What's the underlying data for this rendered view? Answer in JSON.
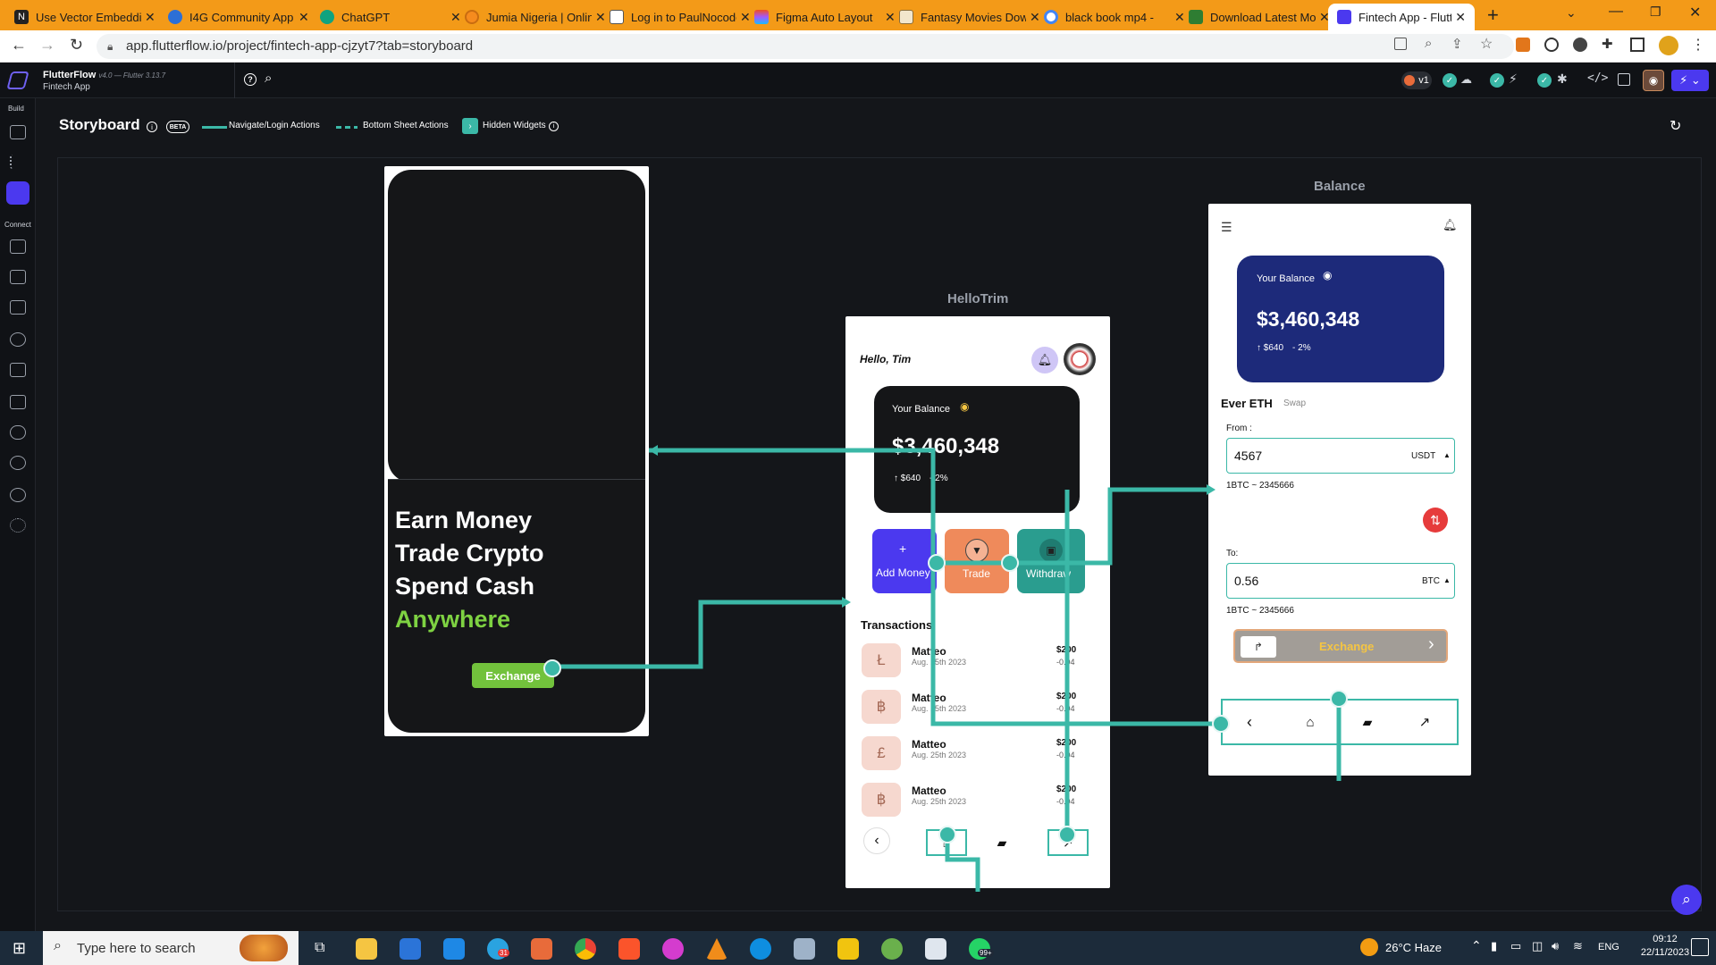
{
  "browser": {
    "tabs": [
      {
        "label": "Use Vector Embedding",
        "icon": "notion-icon",
        "color": "#222222"
      },
      {
        "label": "I4G Community App",
        "icon": "globe-icon",
        "color": "#2c6fd6"
      },
      {
        "label": "ChatGPT",
        "icon": "openai-icon",
        "color": "#10a37f"
      },
      {
        "label": "Jumia Nigeria | Online",
        "icon": "jumia-icon",
        "color": "#f68b1e"
      },
      {
        "label": "Log in to PaulNocode",
        "icon": "page-icon",
        "color": "#555555"
      },
      {
        "label": "Figma Auto Layout",
        "icon": "figma-icon",
        "color": "#a259ff"
      },
      {
        "label": "Fantasy Movies Download",
        "icon": "page-icon",
        "color": "#8a6d3b"
      },
      {
        "label": "black book mp4 -",
        "icon": "google-icon",
        "color": "#4285f4"
      },
      {
        "label": "Download Latest Movies",
        "icon": "page-icon",
        "color": "#2e7d32"
      },
      {
        "label": "Fintech App - Flutter",
        "icon": "flutterflow-icon",
        "color": "#4b39ef"
      }
    ],
    "url": "app.flutterflow.io/project/fintech-app-cjzyt7?tab=storyboard"
  },
  "ff": {
    "brand": "FlutterFlow",
    "version": "v4.0 — Flutter 3.13.7",
    "project": "Fintech App",
    "rail_build": "Build",
    "rail_connect": "Connect",
    "version_badge": "v1"
  },
  "storyboard": {
    "title": "Storyboard",
    "beta": "BETA",
    "legend_navigate": "Navigate/Login Actions",
    "legend_bottom": "Bottom Sheet Actions",
    "legend_hidden": "Hidden Widgets"
  },
  "onboarding": {
    "line1": "Earn Money",
    "line2": "Trade Crypto",
    "line3": "Spend Cash",
    "line4": "Anywhere",
    "button": "Exchange"
  },
  "hellotrim": {
    "page_title": "HelloTrim",
    "greeting": "Hello, Tim",
    "balance_label": "Your Balance",
    "balance": "$3,460,348",
    "change_amount": "$640",
    "change_pct": "- 2%",
    "action_add": "Add Money",
    "action_trade": "Trade",
    "action_withdraw": "Withdraw",
    "transactions_title": "Transactions",
    "transactions": [
      {
        "name": "Matteo",
        "date": "Aug. 25th 2023",
        "amount": "$200",
        "change": "-0.04",
        "icon": "Ł"
      },
      {
        "name": "Matteo",
        "date": "Aug. 25th 2023",
        "amount": "$200",
        "change": "-0.04",
        "icon": "฿"
      },
      {
        "name": "Matteo",
        "date": "Aug. 25th 2023",
        "amount": "$200",
        "change": "-0.04",
        "icon": "£"
      },
      {
        "name": "Matteo",
        "date": "Aug. 25th 2023",
        "amount": "$200",
        "change": "-0.04",
        "icon": "฿"
      }
    ]
  },
  "balance_page": {
    "page_title": "Balance",
    "balance_label": "Your Balance",
    "balance": "$3,460,348",
    "change_amount": "$640",
    "change_pct": "- 2%",
    "ever_eth": "Ever ETH",
    "swap": "Swap",
    "from_label": "From :",
    "from_value": "4567",
    "from_currency": "USDT",
    "rate1": "1BTC ~ 2345666",
    "to_label": "To:",
    "to_value": "0.56",
    "to_currency": "BTC",
    "rate2": "1BTC ~ 2345666",
    "exchange": "Exchange"
  },
  "taskbar": {
    "search_placeholder": "Type here to search",
    "weather": "26°C  Haze",
    "lang": "ENG",
    "time": "09:12",
    "date": "22/11/2023",
    "whatsapp_badge": "99+",
    "telegram_badge": "31"
  },
  "colors": {
    "accent": "#3bb8a7",
    "ffbg": "#14161a",
    "navy_card": "#1d2a7a",
    "dark_card": "#151618",
    "green_text": "#7ed242",
    "add_money": "#4b39ef",
    "trade": "#ef8a5b",
    "withdraw": "#2a9d8f"
  }
}
